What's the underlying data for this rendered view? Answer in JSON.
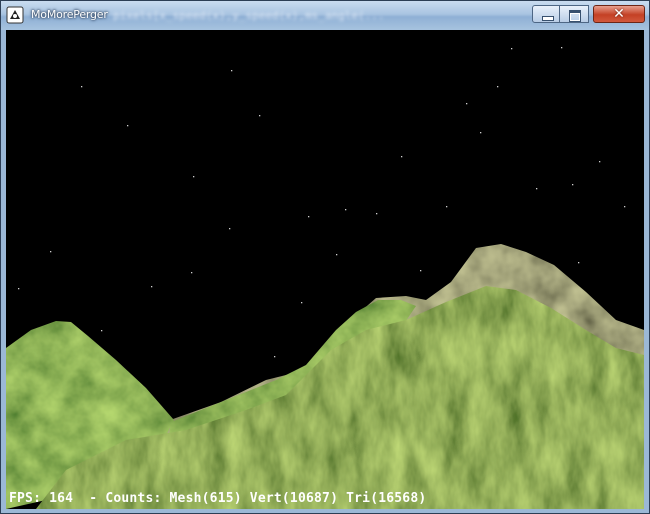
{
  "window": {
    "title": "MoMorePerger",
    "title_blurred": "pixels[x_speed(x),y_speed(x),ms_angle(...",
    "app_icon": "app-icon",
    "controls": {
      "minimize_icon": "minimize-icon",
      "maximize_icon": "maximize-icon",
      "close_glyph": "✕"
    }
  },
  "scene": {
    "description_icon": "terrain-3d-render",
    "sky_color": "#000000",
    "terrain_colors": [
      "#5f8a2a",
      "#3c5f1e",
      "#8aa33a",
      "#2e4a16",
      "#a6a068"
    ]
  },
  "hud": {
    "text": "FPS: 164  - Counts: Mesh(615) Vert(10687) Tri(16568)"
  }
}
